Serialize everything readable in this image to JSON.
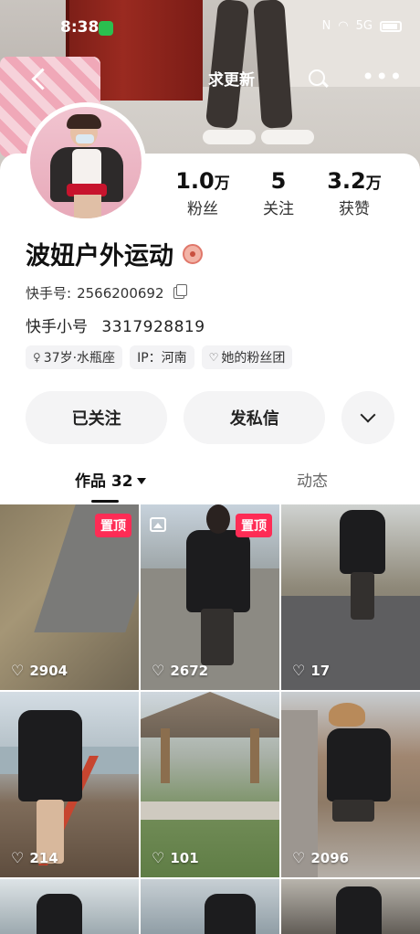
{
  "status": {
    "time": "8:38",
    "signal": "5G"
  },
  "topbar": {
    "update_label": "求更新"
  },
  "profile": {
    "name": "波妞户外运动",
    "stats": [
      {
        "num": "1.0",
        "unit": "万",
        "label": "粉丝"
      },
      {
        "num": "5",
        "unit": "",
        "label": "关注"
      },
      {
        "num": "3.2",
        "unit": "万",
        "label": "获赞"
      }
    ],
    "kuaishou_id_label": "快手号:",
    "kuaishou_id": "2566200692",
    "alt_id_label": "快手小号",
    "alt_id": "3317928819",
    "tags": [
      "37岁·水瓶座",
      "IP：河南",
      "她的粉丝团"
    ]
  },
  "actions": {
    "follow": "已关注",
    "message": "发私信"
  },
  "tabs": {
    "works": "作品 32",
    "dynamic": "动态"
  },
  "posts": [
    {
      "likes": "2904",
      "pinned": "置顶"
    },
    {
      "likes": "2672",
      "pinned": "置顶"
    },
    {
      "likes": "17",
      "pinned": ""
    },
    {
      "likes": "214",
      "pinned": ""
    },
    {
      "likes": "101",
      "pinned": ""
    },
    {
      "likes": "2096",
      "pinned": ""
    }
  ],
  "colors": {
    "pin": "#fe2c55",
    "accent": "#111111"
  }
}
